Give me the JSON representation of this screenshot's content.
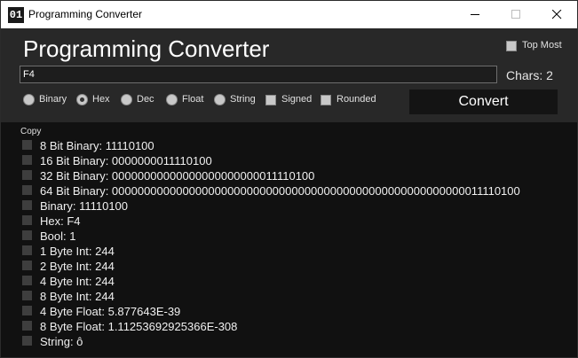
{
  "window": {
    "title": "Programming Converter",
    "icon_text": "01"
  },
  "header": {
    "title": "Programming Converter",
    "top_most_label": "Top Most",
    "top_most_checked": false
  },
  "input": {
    "value": "F4"
  },
  "chars_label": "Chars: 2",
  "options": {
    "binary": "Binary",
    "hex": "Hex",
    "dec": "Dec",
    "float": "Float",
    "string": "String",
    "signed": "Signed",
    "rounded": "Rounded",
    "selected": "Hex"
  },
  "convert_label": "Convert",
  "copy_label": "Copy",
  "results": [
    "8 Bit Binary: 11110100",
    "16 Bit Binary: 0000000011110100",
    "32 Bit Binary: 00000000000000000000000011110100",
    "64 Bit Binary: 0000000000000000000000000000000000000000000000000000000011110100",
    "Binary: 11110100",
    "Hex: F4",
    "Bool: 1",
    "1 Byte Int: 244",
    "2 Byte Int: 244",
    "4 Byte Int: 244",
    "8 Byte Int: 244",
    "4 Byte Float: 5.877643E-39",
    "8 Byte Float: 1.11253692925366E-308",
    "String: ô"
  ],
  "colors": {
    "panel": "#282828",
    "body": "#111111",
    "button": "#141414"
  }
}
